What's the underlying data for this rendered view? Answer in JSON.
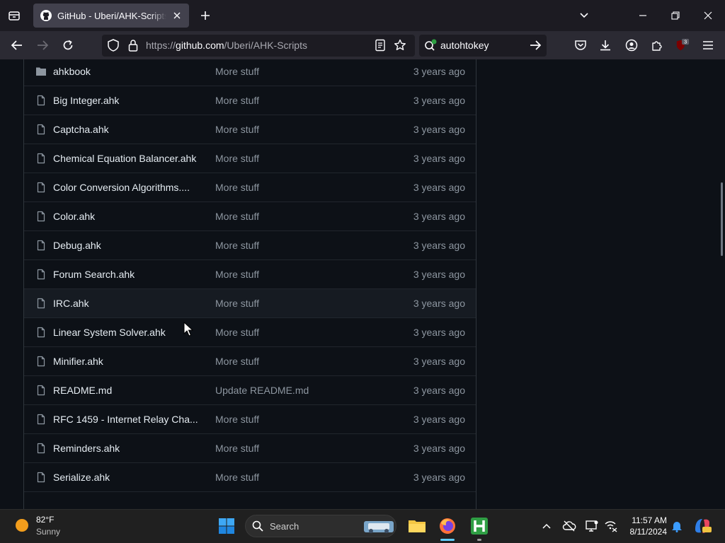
{
  "browser": {
    "tab_title": "GitHub - Uberi/AHK-Scripts: A",
    "url_prefix": "https://",
    "url_host": "github.com",
    "url_path": "/Uberi/AHK-Scripts",
    "search_query": "autohtokey",
    "extension_badge": "3"
  },
  "files": [
    {
      "name": "ahkbook",
      "type": "folder",
      "message": "More stuff",
      "age": "3 years ago"
    },
    {
      "name": "Big Integer.ahk",
      "type": "file",
      "message": "More stuff",
      "age": "3 years ago"
    },
    {
      "name": "Captcha.ahk",
      "type": "file",
      "message": "More stuff",
      "age": "3 years ago"
    },
    {
      "name": "Chemical Equation Balancer.ahk",
      "type": "file",
      "message": "More stuff",
      "age": "3 years ago"
    },
    {
      "name": "Color Conversion Algorithms....",
      "type": "file",
      "message": "More stuff",
      "age": "3 years ago"
    },
    {
      "name": "Color.ahk",
      "type": "file",
      "message": "More stuff",
      "age": "3 years ago"
    },
    {
      "name": "Debug.ahk",
      "type": "file",
      "message": "More stuff",
      "age": "3 years ago"
    },
    {
      "name": "Forum Search.ahk",
      "type": "file",
      "message": "More stuff",
      "age": "3 years ago"
    },
    {
      "name": "IRC.ahk",
      "type": "file",
      "message": "More stuff",
      "age": "3 years ago"
    },
    {
      "name": "Linear System Solver.ahk",
      "type": "file",
      "message": "More stuff",
      "age": "3 years ago"
    },
    {
      "name": "Minifier.ahk",
      "type": "file",
      "message": "More stuff",
      "age": "3 years ago"
    },
    {
      "name": "README.md",
      "type": "file",
      "message": "Update README.md",
      "age": "3 years ago"
    },
    {
      "name": "RFC 1459 - Internet Relay Cha...",
      "type": "file",
      "message": "More stuff",
      "age": "3 years ago"
    },
    {
      "name": "Reminders.ahk",
      "type": "file",
      "message": "More stuff",
      "age": "3 years ago"
    },
    {
      "name": "Serialize.ahk",
      "type": "file",
      "message": "More stuff",
      "age": "3 years ago"
    }
  ],
  "taskbar": {
    "weather_temp": "82°F",
    "weather_desc": "Sunny",
    "search_placeholder": "Search",
    "time": "11:57 AM",
    "date": "8/11/2024"
  },
  "colors": {
    "page_bg": "#0d1117",
    "text": "#e6edf3",
    "muted": "#8d96a0",
    "border": "#21262d",
    "browser_toolbar": "#2b2a33",
    "browser_tabbar": "#1c1b22"
  }
}
